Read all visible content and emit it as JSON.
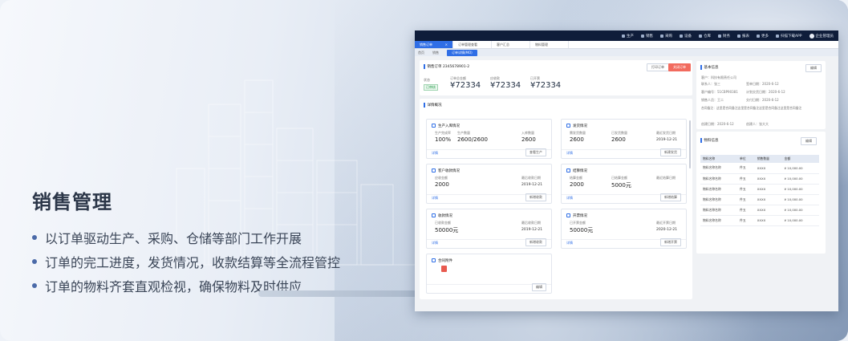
{
  "slide": {
    "heading": "销售管理",
    "bullets": [
      "以订单驱动生产、采购、仓储等部门工作开展",
      "订单的完工进度，发货情况，收款结算等全流程管控",
      "订单的物料齐套直观检视，确保物料及时供应"
    ]
  },
  "topbar": {
    "nav": [
      "生产",
      "销售",
      "采购",
      "设备",
      "仓库",
      "财务",
      "报表",
      "更多"
    ],
    "app_download": "扫描下载APP",
    "user": "企业管理员"
  },
  "tabs": [
    {
      "label": "销售订单",
      "active": true
    },
    {
      "label": "订单管理查看",
      "active": false
    },
    {
      "label": "客户汇总",
      "active": false
    },
    {
      "label": "物料管理",
      "active": false
    }
  ],
  "breadcrumb": [
    "首页",
    "销售",
    "订单详情(MO)"
  ],
  "order": {
    "title": "销售订单",
    "number": "2345678901-2",
    "btn_print": "打印订单",
    "btn_close": "关闭订单",
    "status_label": "状态",
    "status": "已审核",
    "amounts": [
      {
        "label": "订单总金额",
        "value": "¥72334"
      },
      {
        "label": "应收款",
        "value": "¥72334"
      },
      {
        "label": "已开票",
        "value": "¥72334"
      }
    ]
  },
  "progress_title": "详情概况",
  "mini": [
    {
      "title": "生产入库情况",
      "labels": [
        "生产完成率",
        "生产数量",
        "入库数量"
      ],
      "values": [
        "100%",
        "2600/2600",
        "2600"
      ],
      "link": "详情",
      "btn": "查看生产"
    },
    {
      "title": "发货情况",
      "labels": [
        "需发货数量",
        "已发货数量",
        "最近发货日期"
      ],
      "values": [
        "2600",
        "2600",
        "2019-12-21"
      ],
      "link": "详情",
      "btn": "新建发货"
    },
    {
      "title": "客户收款情况",
      "labels": [
        "应收金额",
        "最后收款日期"
      ],
      "values": [
        "2000",
        "2019-12-21"
      ],
      "link": "详情",
      "btn": "新增收款"
    },
    {
      "title": "结算情况",
      "labels": [
        "结算金额",
        "已结算金额",
        "最近结算日期"
      ],
      "values": [
        "2000",
        "5000元",
        ""
      ],
      "link": "详情",
      "btn": "新增结算"
    },
    {
      "title": "收款情况",
      "labels": [
        "已收款金额",
        "最后收款日期"
      ],
      "values": [
        "50000元",
        "2019-12-21"
      ],
      "link": "详情",
      "btn": "新增收款"
    },
    {
      "title": "开票情况",
      "labels": [
        "已开票金额",
        "最近开票日期"
      ],
      "values": [
        "50000元",
        "2020-12-21"
      ],
      "link": "详情",
      "btn": "新增开票"
    },
    {
      "title": "合同附件",
      "btn": "编辑"
    }
  ],
  "info": {
    "title": "基本信息",
    "edit": "编辑",
    "customer": "客户：科技有限责任公司",
    "rows": [
      "联系人：张三",
      "签单日期：2020-6-12",
      "客户编号：51CBP90381",
      "计划交货日期：2020-6-12",
      "销售人员：王二",
      "交付日期：2020-6-12"
    ],
    "remark": "合同备注：这里是合同备注这里是合同备注这里是合同备注这里是合同备注",
    "created": "创建日期：2020-6-12",
    "creator": "创建人：张大大"
  },
  "materials": {
    "title": "物料信息",
    "edit": "编辑",
    "headers": [
      "物料名称",
      "单位",
      "销售数量",
      "金额"
    ],
    "rows": [
      [
        "物料名称名称",
        "件五",
        "XXXX",
        "¥ 10,000.00"
      ],
      [
        "物料名称名称",
        "件五",
        "XXXX",
        "¥ 10,000.00"
      ],
      [
        "物料名称名称",
        "件五",
        "XXXX",
        "¥ 10,000.00"
      ],
      [
        "物料名称名称",
        "件五",
        "XXXX",
        "¥ 10,000.00"
      ],
      [
        "物料名称名称",
        "件五",
        "XXXX",
        "¥ 10,000.00"
      ],
      [
        "物料名称名称",
        "件五",
        "XXXX",
        "¥ 10,000.00"
      ]
    ]
  }
}
